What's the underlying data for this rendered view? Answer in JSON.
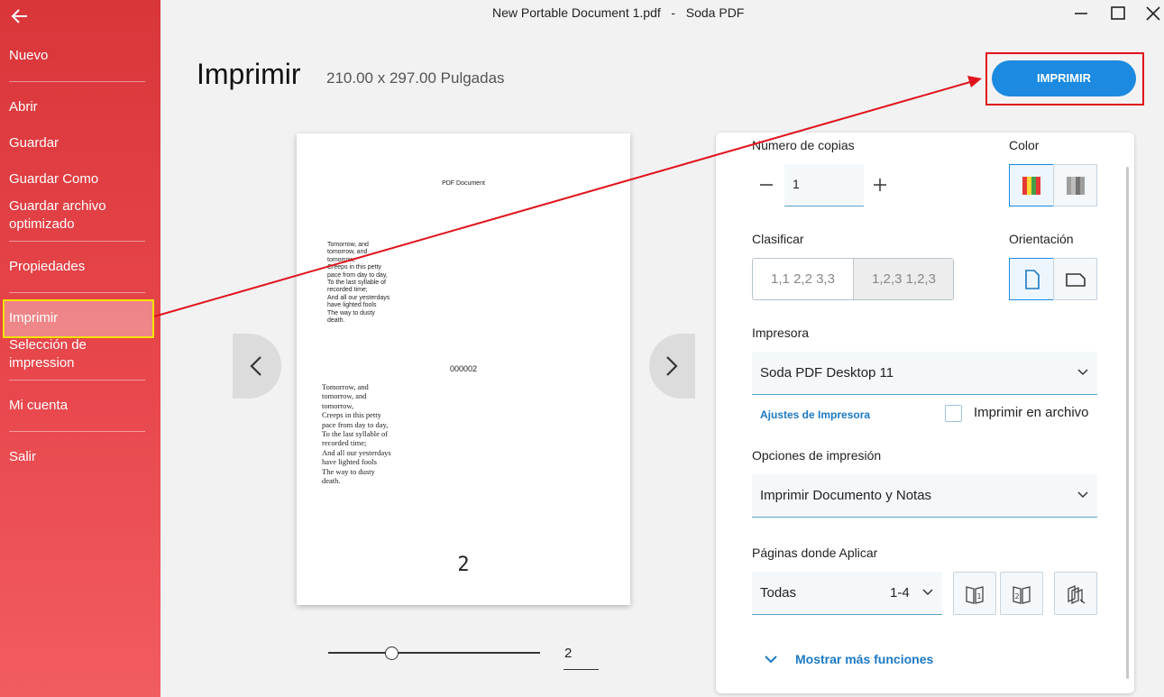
{
  "window": {
    "title": "New Portable Document 1.pdf   -   Soda PDF"
  },
  "sidebar": {
    "items": [
      {
        "label": "Nuevo"
      },
      {
        "label": "Abrir"
      },
      {
        "label": "Guardar"
      },
      {
        "label": "Guardar Como"
      },
      {
        "label": "Guardar archivo optimizado"
      },
      {
        "label": "Propiedades"
      },
      {
        "label": "Imprimir"
      },
      {
        "label": "Selección de impression"
      },
      {
        "label": "Mi cuenta"
      },
      {
        "label": "Salir"
      }
    ],
    "active": "Imprimir"
  },
  "header": {
    "title": "Imprimir",
    "dimensions": "210.00 x 297.00 Pulgadas",
    "print_button": "IMPRIMIR"
  },
  "preview": {
    "header_text": "PDF Document",
    "poem_sans": "Tomorrow, and\ntomorrow, and\ntomorrow,\nCreeps in this petty\npace from day to day,\nTo the last syllable of\nrecorded time;\nAnd all our yesterdays\nhave lighted fools\nThe way to dusty\ndeath.",
    "number_text": "000002",
    "poem_serif": "Tomorrow, and\ntomorrow, and\ntomorrow,\nCreeps in this petty\npace from day to day,\nTo the last syllable of\nrecorded time;\nAnd all our yesterdays\nhave lighted fools\nThe way to dusty\ndeath.",
    "page_number": "2",
    "current_page": "2",
    "zoom_level_fraction": 0.3
  },
  "settings": {
    "copies_label": "Número de copias",
    "copies_value": "1",
    "color_label": "Color",
    "sort_label": "Clasificar",
    "sort_options": [
      "1,1 2,2 3,3",
      "1,2,3 1,2,3"
    ],
    "orientation_label": "Orientación",
    "printer_label": "Impresora",
    "printer_value": "Soda PDF Desktop 11",
    "printer_settings_link": "Ajustes de Impresora",
    "print_to_file_label": "Imprimir en archivo",
    "print_options_label": "Opciones de impresión",
    "print_options_value": "Imprimir Documento y Notas",
    "pages_label": "Páginas donde Aplicar",
    "pages_value": "Todas",
    "pages_range": "1-4",
    "more_functions": "Mostrar más funciones"
  },
  "colors": {
    "sidebar_top": "#d9363a",
    "sidebar_bottom": "#f15c60",
    "accent": "#1b8ae0",
    "annotation_red": "#e0131b",
    "annotation_yellow": "#f5e200"
  }
}
